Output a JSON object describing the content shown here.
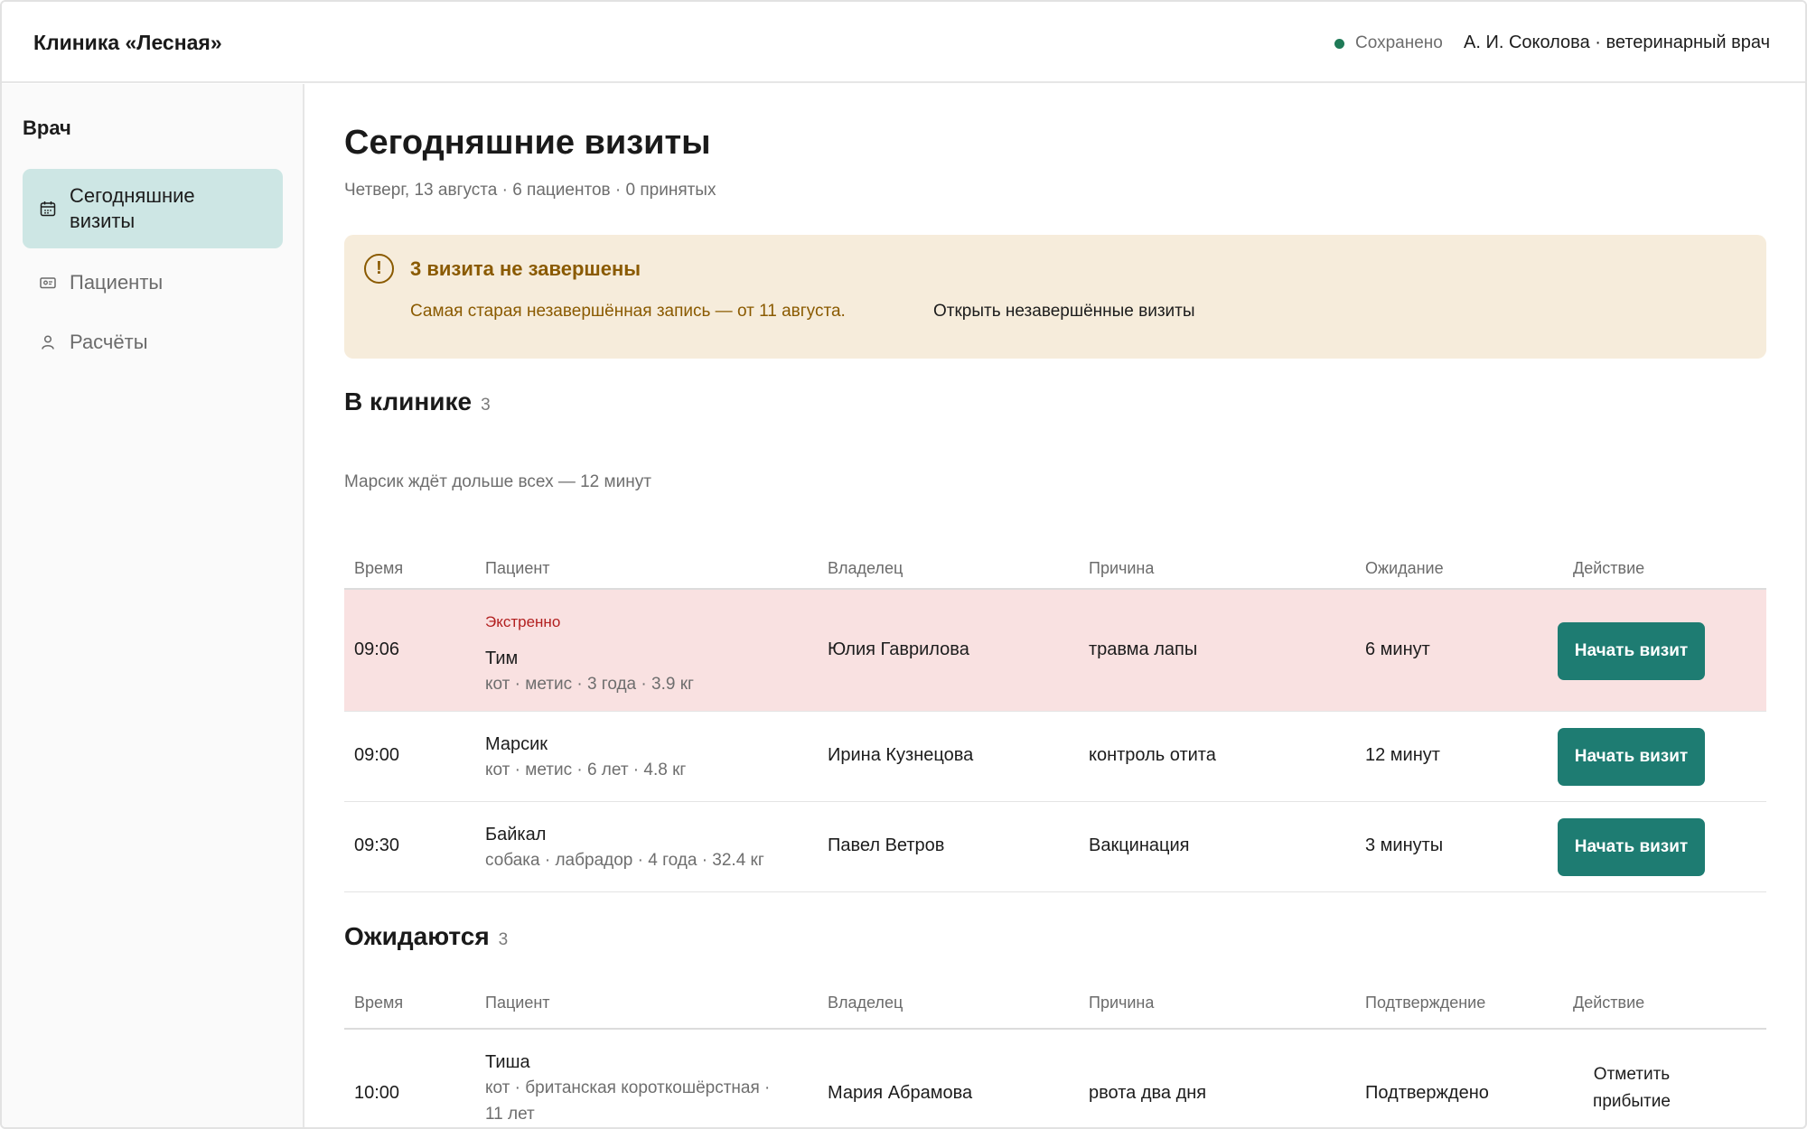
{
  "header": {
    "app_title": "Клиника «Лесная»",
    "save_status": "Сохранено",
    "user": "А. И. Соколова · ветеринарный врач"
  },
  "sidebar": {
    "heading": "Врач",
    "items": [
      {
        "label": "Сегодняшние визиты",
        "icon": "calendar-icon",
        "active": true
      },
      {
        "label": "Пациенты",
        "icon": "id-card-icon",
        "active": false
      },
      {
        "label": "Расчёты",
        "icon": "person-icon",
        "active": false
      }
    ]
  },
  "main": {
    "title": "Сегодняшние визиты",
    "subtitle": "Четверг, 13 августа · 6 пациентов · 0 принятых",
    "alert": {
      "icon": "!",
      "title": "3 визита не завершены",
      "text": "Самая старая незавершённая запись — от 11 августа.",
      "link": "Открыть незавершённые визиты"
    },
    "in_clinic": {
      "title": "В клинике",
      "count": "3",
      "note": "Марсик ждёт дольше всех — 12 минут",
      "columns": [
        "Время",
        "Пациент",
        "Владелец",
        "Причина",
        "Ожидание",
        "Действие"
      ],
      "rows": [
        {
          "time": "09:06",
          "tag": "Экстренно",
          "pet": "Тим",
          "details": "кот · метис · 3 года · 3.9 кг",
          "owner": "Юлия Гаврилова",
          "reason": "травма лапы",
          "wait": "6 минут",
          "action": "Начать визит"
        },
        {
          "time": "09:00",
          "tag": "",
          "pet": "Марсик",
          "details": "кот · метис · 6 лет · 4.8 кг",
          "owner": "Ирина Кузнецова",
          "reason": "контроль отита",
          "wait": "12 минут",
          "action": "Начать визит"
        },
        {
          "time": "09:30",
          "tag": "",
          "pet": "Байкал",
          "details": "собака · лабрадор · 4 года · 32.4 кг",
          "owner": "Павел Ветров",
          "reason": "Вакцинация",
          "wait": "3 минуты",
          "action": "Начать визит"
        }
      ]
    },
    "expected": {
      "title": "Ожидаются",
      "count": "3",
      "columns": [
        "Время",
        "Пациент",
        "Владелец",
        "Причина",
        "Подтверждение",
        "Действие"
      ],
      "rows": [
        {
          "time": "10:00",
          "pet": "Тиша",
          "details_line1": "кот · британская короткошёрстная ·",
          "details_line2": "11 лет",
          "owner": "Мария Абрамова",
          "reason": "рвота два дня",
          "confirmation": "Подтверждено",
          "action_line1": "Отметить",
          "action_line2": "прибытие"
        }
      ]
    }
  },
  "colors": {
    "accent": "#1e7c72",
    "active_nav": "#cde6e4",
    "alert_bg": "#f6ecdb",
    "alert_text": "#8a5a00",
    "urgent_bg": "#f9e1e1",
    "urgent_text": "#b21f1f",
    "saved_dot": "#1f7a57"
  }
}
